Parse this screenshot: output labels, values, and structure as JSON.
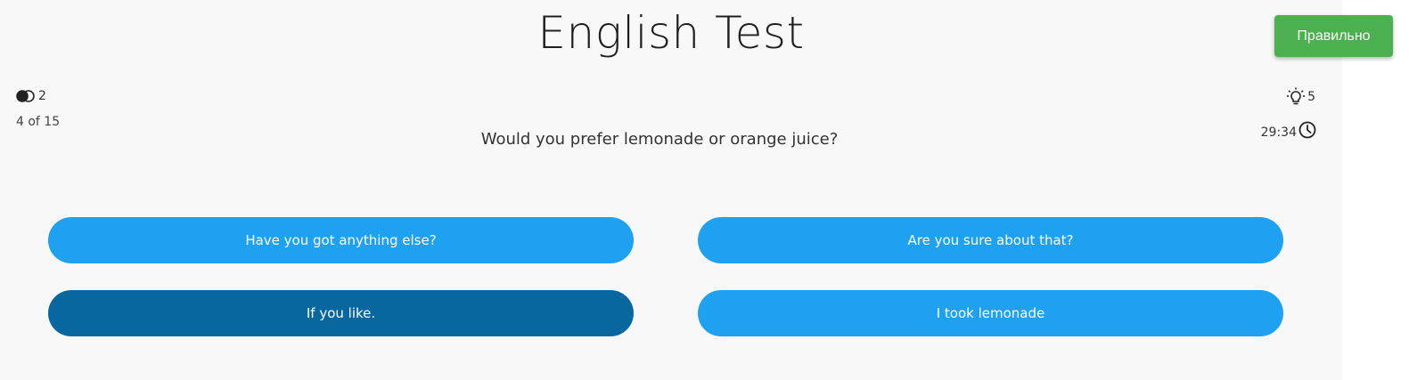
{
  "quiz": {
    "title": "English Test",
    "lives": "2",
    "progress": "4 of 15",
    "hints": "5",
    "timer": "29:34",
    "question": "Would you prefer lemonade or orange juice?",
    "answers": [
      {
        "label": "Have you got anything else?"
      },
      {
        "label": "Are you sure about that?"
      },
      {
        "label": "If you like.",
        "selected": true
      },
      {
        "label": "I took lemonade"
      }
    ]
  },
  "toast": {
    "message": "Правильно"
  },
  "colors": {
    "answer": "#1fa1f1",
    "answer_selected": "#09679f",
    "toast": "#4caf50",
    "background": "#f8f8f8"
  },
  "icons": {
    "lives": "overlapping-circles-icon",
    "hints": "lightbulb-icon",
    "timer": "clock-icon"
  }
}
